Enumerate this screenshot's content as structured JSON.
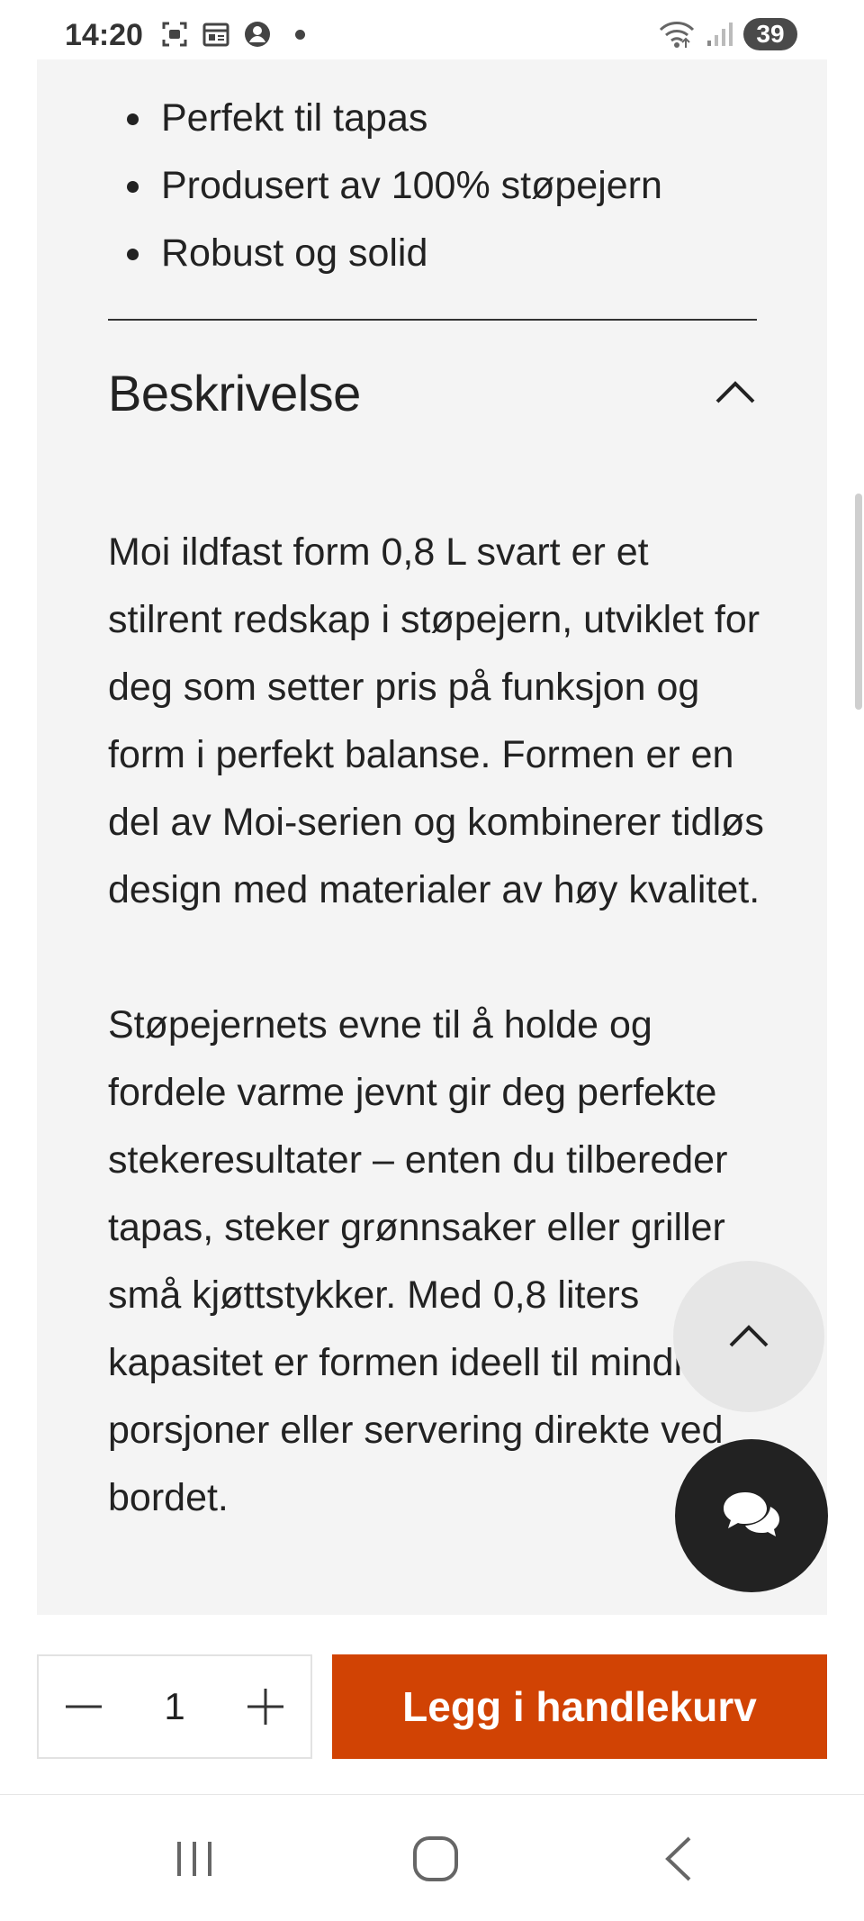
{
  "status_bar": {
    "time": "14:20",
    "battery": "39",
    "icons": [
      "screenshot-icon",
      "calendar-icon",
      "account-icon",
      "dot-icon",
      "wifi-icon",
      "signal-icon"
    ]
  },
  "features": {
    "items": [
      "Perfekt til tapas",
      "Produsert av 100% støpejern",
      "Robust og solid"
    ]
  },
  "description_section": {
    "title": "Beskrivelse",
    "expanded": true,
    "paragraphs": [
      "Moi ildfast form 0,8 L svart er et stilrent redskap i støpejern, utviklet for deg som setter pris på funksjon og form i perfekt balanse. Formen er en del av Moi-serien og kombinerer tidløs design med materialer av høy kvalitet.",
      "Støpejernets evne til å holde og fordele varme jevnt gir deg perfekte stekeresultater – enten du tilbereder tapas, steker grønnsaker eller griller små kjøttstykker. Med 0,8 liters kapasitet er formen ideell til mindre porsjoner eller servering direkte ved bordet."
    ]
  },
  "purchase": {
    "quantity": "1",
    "add_to_cart_label": "Legg i handlekurv"
  },
  "colors": {
    "accent": "#d14304",
    "card_background": "#f4f4f4",
    "chat_button": "#222222",
    "scroll_top_button": "#e6e6e6"
  }
}
